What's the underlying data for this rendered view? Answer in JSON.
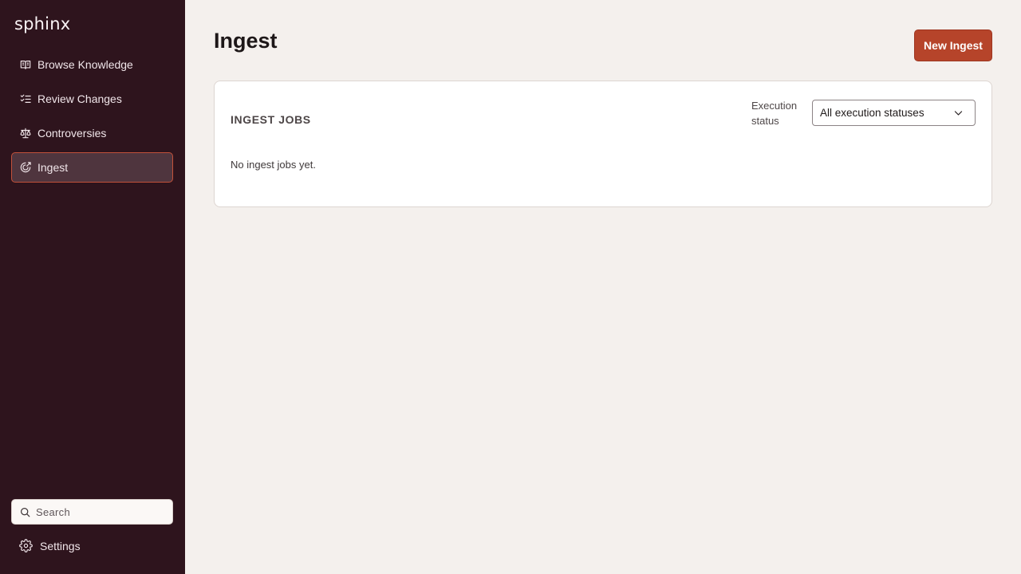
{
  "app": {
    "logo": "sphinx"
  },
  "sidebar": {
    "items": [
      {
        "label": "Browse Knowledge",
        "icon": "book-icon"
      },
      {
        "label": "Review Changes",
        "icon": "checklist-icon"
      },
      {
        "label": "Controversies",
        "icon": "scale-icon"
      },
      {
        "label": "Ingest",
        "icon": "ingest-icon",
        "active": true
      }
    ],
    "search": {
      "placeholder": "Search"
    },
    "settings_label": "Settings"
  },
  "main": {
    "title": "Ingest",
    "new_button_label": "New Ingest",
    "card": {
      "title": "INGEST JOBS",
      "filter_label": "Execution status",
      "filter_value": "All execution statuses",
      "empty_text": "No ingest jobs yet."
    }
  },
  "colors": {
    "sidebar_bg": "#2e141d",
    "accent": "#b6442a",
    "page_bg": "#f4f0ed"
  }
}
